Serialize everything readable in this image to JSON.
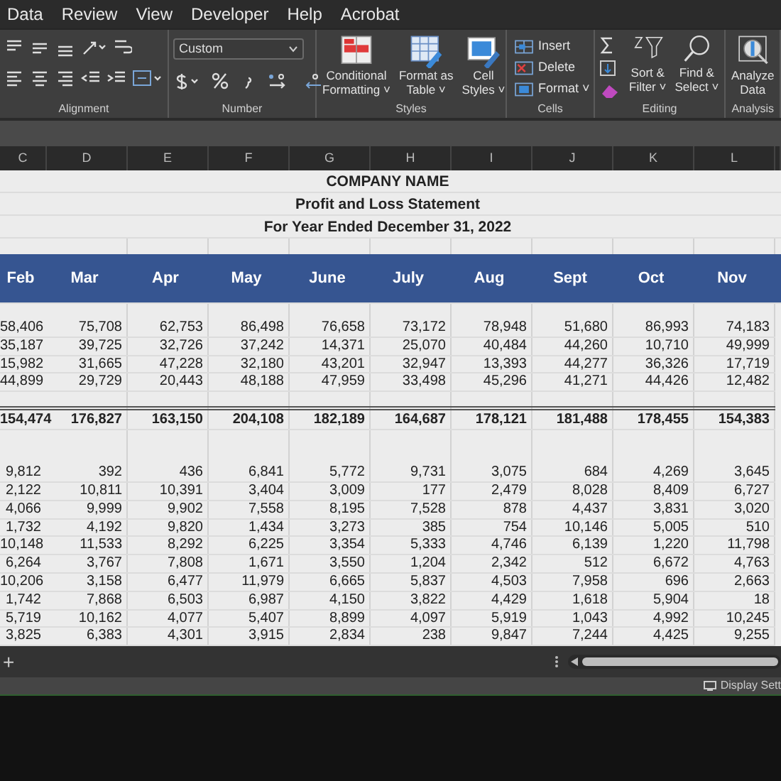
{
  "menu_tabs": [
    "Data",
    "Review",
    "View",
    "Developer",
    "Help",
    "Acrobat"
  ],
  "ribbon": {
    "groups": [
      {
        "kind": "alignment",
        "label": "Alignment"
      },
      {
        "kind": "number",
        "label": "Number",
        "number_format": "Custom"
      },
      {
        "kind": "styles",
        "label": "Styles",
        "buttons": [
          {
            "lines": [
              "Conditional",
              "Formatting ˅"
            ]
          },
          {
            "lines": [
              "Format as",
              "Table ˅"
            ]
          },
          {
            "lines": [
              "Cell",
              "Styles ˅"
            ]
          }
        ]
      },
      {
        "kind": "cells",
        "label": "Cells",
        "buttons": [
          {
            "text": "Insert"
          },
          {
            "text": "Delete"
          },
          {
            "text": "Format ˅"
          }
        ]
      },
      {
        "kind": "editing",
        "label": "Editing",
        "buttons": [
          {
            "lines": [
              "Sort &",
              "Filter ˅"
            ]
          },
          {
            "lines": [
              "Find &",
              "Select ˅"
            ]
          }
        ]
      },
      {
        "kind": "analysis",
        "label": "Analysis",
        "buttons": [
          {
            "lines": [
              "Analyze",
              "Data"
            ]
          }
        ]
      }
    ]
  },
  "sheet": {
    "column_letters": [
      "C",
      "D",
      "E",
      "F",
      "G",
      "H",
      "I",
      "J",
      "K",
      "L"
    ],
    "title_lines": [
      "COMPANY NAME",
      "Profit and Loss Statement",
      "For Year Ended December 31, 2022"
    ],
    "month_headers": [
      "Feb",
      "Mar",
      "Apr",
      "May",
      "June",
      "July",
      "Aug",
      "Sept",
      "Oct",
      "Nov"
    ],
    "revenue_rows": [
      [
        "58,406",
        "75,708",
        "62,753",
        "86,498",
        "76,658",
        "73,172",
        "78,948",
        "51,680",
        "86,993",
        "74,183"
      ],
      [
        "35,187",
        "39,725",
        "32,726",
        "37,242",
        "14,371",
        "25,070",
        "40,484",
        "44,260",
        "10,710",
        "49,999"
      ],
      [
        "15,982",
        "31,665",
        "47,228",
        "32,180",
        "43,201",
        "32,947",
        "13,393",
        "44,277",
        "36,326",
        "17,719"
      ],
      [
        "44,899",
        "29,729",
        "20,443",
        "48,188",
        "47,959",
        "33,498",
        "45,296",
        "41,271",
        "44,426",
        "12,482"
      ]
    ],
    "total_row": [
      "154,474",
      "176,827",
      "163,150",
      "204,108",
      "182,189",
      "164,687",
      "178,121",
      "181,488",
      "178,455",
      "154,383"
    ],
    "expense_rows": [
      [
        "9,812",
        "392",
        "436",
        "6,841",
        "5,772",
        "9,731",
        "3,075",
        "684",
        "4,269",
        "3,645"
      ],
      [
        "2,122",
        "10,811",
        "10,391",
        "3,404",
        "3,009",
        "177",
        "2,479",
        "8,028",
        "8,409",
        "6,727"
      ],
      [
        "4,066",
        "9,999",
        "9,902",
        "7,558",
        "8,195",
        "7,528",
        "878",
        "4,437",
        "3,831",
        "3,020"
      ],
      [
        "1,732",
        "4,192",
        "9,820",
        "1,434",
        "3,273",
        "385",
        "754",
        "10,146",
        "5,005",
        "510"
      ],
      [
        "10,148",
        "11,533",
        "8,292",
        "6,225",
        "3,354",
        "5,333",
        "4,746",
        "6,139",
        "1,220",
        "11,798"
      ],
      [
        "6,264",
        "3,767",
        "7,808",
        "1,671",
        "3,550",
        "1,204",
        "2,342",
        "512",
        "6,672",
        "4,763"
      ],
      [
        "10,206",
        "3,158",
        "6,477",
        "11,979",
        "6,665",
        "5,837",
        "4,503",
        "7,958",
        "696",
        "2,663"
      ],
      [
        "1,742",
        "7,868",
        "6,503",
        "6,987",
        "4,150",
        "3,822",
        "4,429",
        "1,618",
        "5,904",
        "18"
      ],
      [
        "5,719",
        "10,162",
        "4,077",
        "5,407",
        "8,899",
        "4,097",
        "5,919",
        "1,043",
        "4,992",
        "10,245"
      ],
      [
        "3,825",
        "6,383",
        "4,301",
        "3,915",
        "2,834",
        "238",
        "9,847",
        "7,244",
        "4,425",
        "9,255"
      ]
    ]
  },
  "sheet_tabs": {
    "add_button": "+"
  },
  "status_bar": {
    "display_settings": "Display Sett"
  }
}
